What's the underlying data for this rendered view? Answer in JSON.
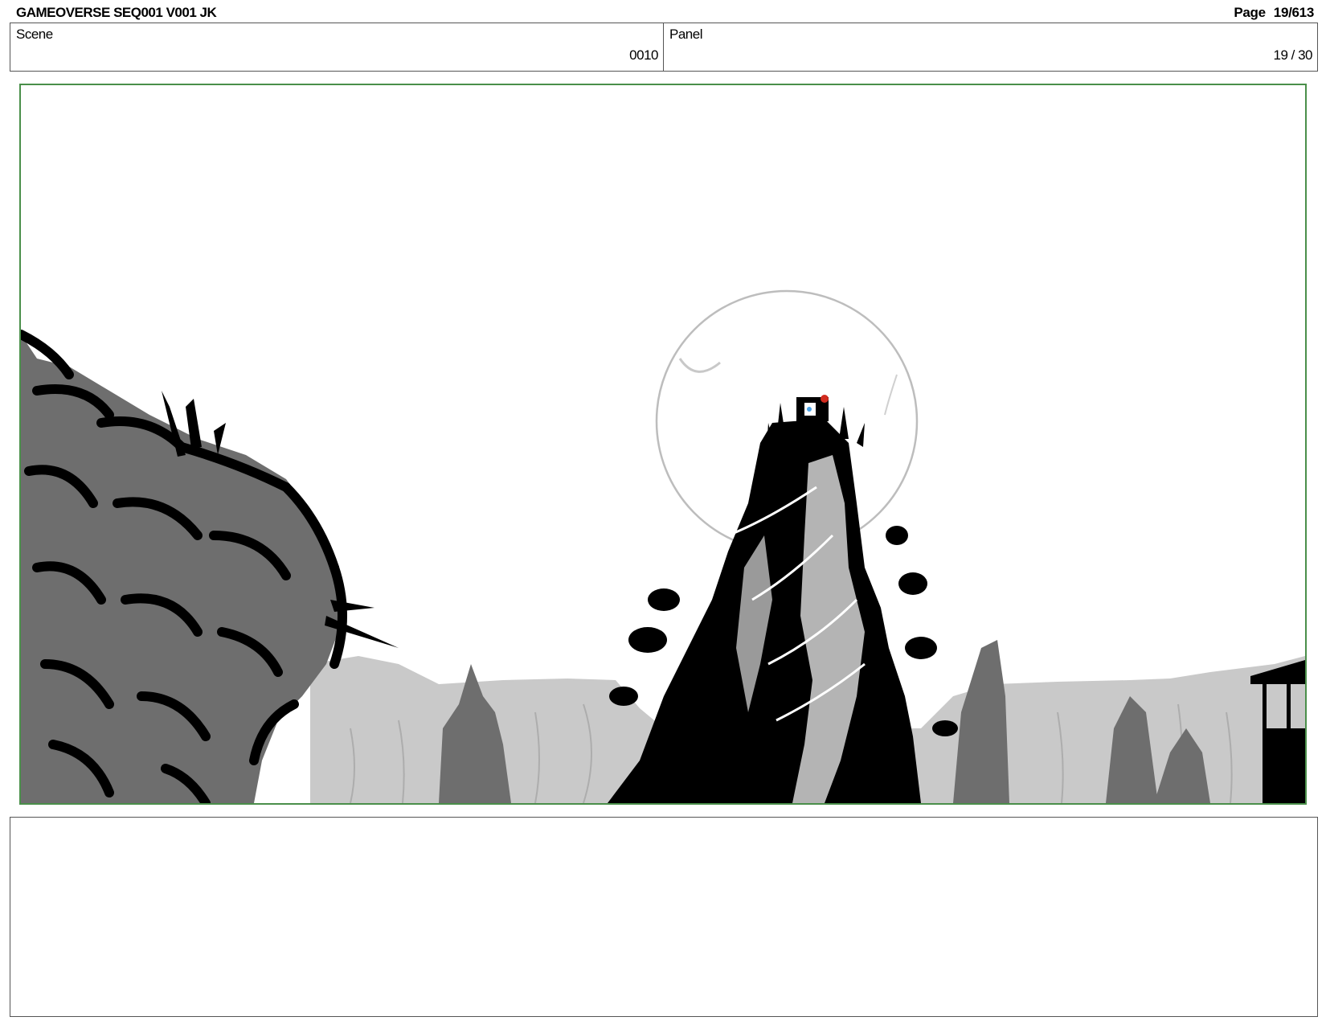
{
  "header": {
    "title": "GAMEOVERSE SEQ001 V001 JK",
    "page_label": "Page",
    "page_value": "19/613"
  },
  "scene": {
    "label": "Scene",
    "value": "0010"
  },
  "panel": {
    "label": "Panel",
    "value": "19 / 30"
  },
  "notes": {
    "text": ""
  },
  "colors": {
    "frame_border": "#4a8f4a",
    "dark_ink": "#000000",
    "mid_gray": "#6e6e6e",
    "light_gray": "#c8c8c8",
    "accent_red": "#d22b1e",
    "accent_blue": "#4aa3e8"
  }
}
